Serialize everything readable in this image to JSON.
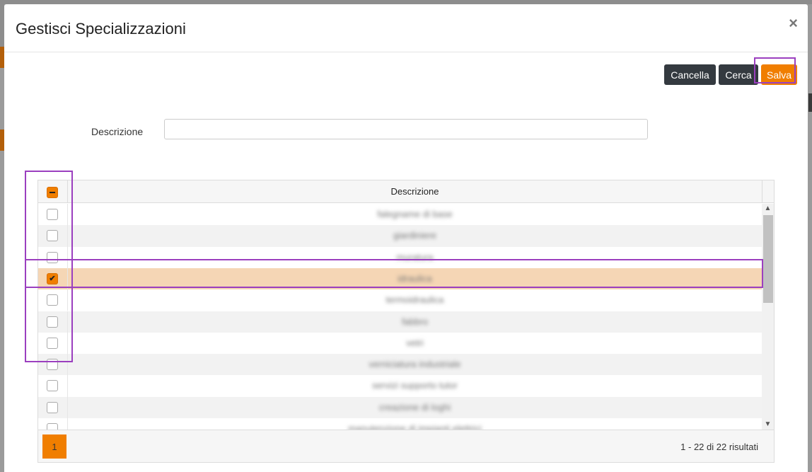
{
  "modal": {
    "title": "Gestisci Specializzazioni",
    "close_symbol": "×"
  },
  "toolbar": {
    "cancella_label": "Cancella",
    "cerca_label": "Cerca",
    "salva_label": "Salva"
  },
  "filter": {
    "label": "Descrizione",
    "value": ""
  },
  "grid": {
    "header": "Descrizione",
    "select_all_state": "indeterminate",
    "rows": [
      {
        "text": "falegname di base",
        "checked": false
      },
      {
        "text": "giardiniere",
        "checked": false
      },
      {
        "text": "muratura",
        "checked": false
      },
      {
        "text": "idraulica",
        "checked": true
      },
      {
        "text": "termoidraulica",
        "checked": false
      },
      {
        "text": "fabbro",
        "checked": false
      },
      {
        "text": "vetri",
        "checked": false
      },
      {
        "text": "verniciatura industriale",
        "checked": false
      },
      {
        "text": "servizi supporto tutor",
        "checked": false
      },
      {
        "text": "creazione di loghi",
        "checked": false
      },
      {
        "text": "manutenzione di impianti elettrici",
        "checked": false
      }
    ],
    "page": "1",
    "pagination_info": "1 - 22 di 22 risultati"
  },
  "colors": {
    "accent": "#f07e00",
    "dark_button": "#343a40",
    "selected_row": "#f5d6b5",
    "annotation": "#9b3fbf"
  }
}
